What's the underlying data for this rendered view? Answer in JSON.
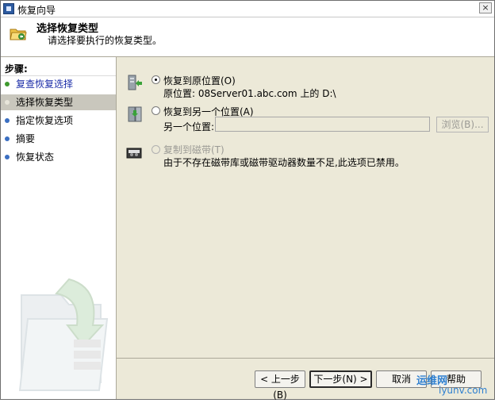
{
  "window": {
    "title": "恢复向导",
    "close_glyph": "×"
  },
  "header": {
    "title": "选择恢复类型",
    "subtitle": "请选择要执行的恢复类型。",
    "icon": "recovery-folder-icon"
  },
  "steps": {
    "label": "步骤:",
    "items": [
      {
        "label": "复查恢复选择",
        "state": "done"
      },
      {
        "label": "选择恢复类型",
        "state": "current"
      },
      {
        "label": "指定恢复选项",
        "state": "todo"
      },
      {
        "label": "摘要",
        "state": "todo"
      },
      {
        "label": "恢复状态",
        "state": "todo"
      }
    ]
  },
  "options": {
    "original": {
      "label": "恢复到原位置(O)",
      "detail": "原位置: 08Server01.abc.com 上的 D:\\",
      "checked": true
    },
    "alternate": {
      "label": "恢复到另一个位置(A)",
      "location_label": "另一个位置:",
      "location_value": "",
      "browse_label": "浏览(B)...",
      "checked": false
    },
    "tape": {
      "label": "复制到磁带(T)",
      "note": "由于不存在磁带库或磁带驱动器数量不足,此选项已禁用。",
      "checked": false,
      "disabled": true
    }
  },
  "footer": {
    "back_label": "< 上一步(B)",
    "next_label": "下一步(N) >",
    "cancel_label": "取消",
    "help_label": "帮助"
  },
  "watermark": {
    "logo": "运维网",
    "site": "iyunv.com"
  },
  "colors": {
    "done_bullet": "#3f9a2f",
    "done_text": "#1b2da8",
    "current_bg": "#c9c7bd",
    "todo_bullet": "#3b6fc2",
    "panel_bg": "#ece9d8"
  }
}
